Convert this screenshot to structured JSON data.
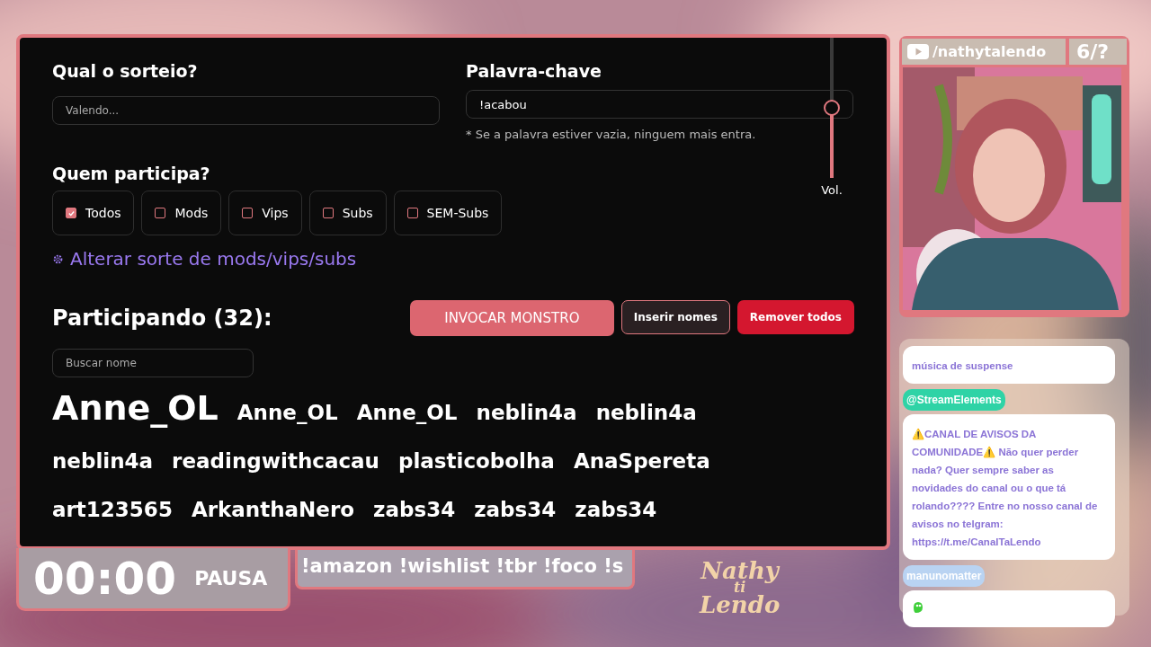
{
  "raffle": {
    "label": "Qual o sorteio?",
    "placeholder": "Valendo..."
  },
  "keyword": {
    "label": "Palavra-chave",
    "value": "!acabou",
    "hint": "* Se a palavra estiver vazia, ninguem mais entra."
  },
  "volume": {
    "label": "Vol.",
    "level": 0.5
  },
  "filter": {
    "label": "Quem participa?",
    "options": [
      {
        "label": "Todos",
        "checked": true
      },
      {
        "label": "Mods",
        "checked": false
      },
      {
        "label": "Vips",
        "checked": false
      },
      {
        "label": "Subs",
        "checked": false
      },
      {
        "label": "SEM-Subs",
        "checked": false
      }
    ]
  },
  "luck_link": "Alterar sorte de mods/vips/subs",
  "participants": {
    "title": "Participando (32):",
    "search": {
      "placeholder": "Buscar nome"
    },
    "actions": [
      {
        "label": "INVOCAR MONSTRO",
        "kind": "primary"
      },
      {
        "label": "Inserir nomes",
        "kind": "secondary"
      },
      {
        "label": "Remover todos",
        "kind": "danger"
      }
    ],
    "names": [
      {
        "name": "Anne_OL",
        "kind": "highlighted"
      },
      {
        "name": "Anne_OL",
        "kind": "normal"
      },
      {
        "name": "Anne_OL",
        "kind": "normal"
      },
      {
        "name": "neblin4a",
        "kind": "normal"
      },
      {
        "name": "neblin4a",
        "kind": "normal"
      },
      {
        "name": "neblin4a",
        "kind": "normal"
      },
      {
        "name": "readingwithcacau",
        "kind": "normal"
      },
      {
        "name": "plasticobolha",
        "kind": "normal"
      },
      {
        "name": "AnaSpereta",
        "kind": "normal"
      },
      {
        "name": "art123565",
        "kind": "normal"
      },
      {
        "name": "ArkanthaNero",
        "kind": "normal"
      },
      {
        "name": "zabs34",
        "kind": "normal"
      },
      {
        "name": "zabs34",
        "kind": "normal"
      },
      {
        "name": "zabs34",
        "kind": "normal"
      }
    ]
  },
  "timer": {
    "time": "00:00",
    "state": "PAUSA"
  },
  "ticker": "!amazon !wishlist !tbr !foco !s",
  "logo": [
    "Nathy",
    "ti",
    "Lendo"
  ],
  "channel": {
    "handle": "/nathytalendo",
    "counter": "6/?"
  },
  "chat": [
    {
      "kind": "text",
      "text": "música de suspense"
    },
    {
      "kind": "text",
      "user": "@StreamElements",
      "color": "#2fd3a6",
      "text": "⚠️CANAL DE AVISOS DA COMUNIDADE⚠️ Não quer perder nada? Quer sempre saber as novidades do canal ou o que tá rolando???? Entre no nosso canal de avisos no telgram: https://t.me/CanalTaLendo"
    },
    {
      "kind": "emote",
      "user": "manunomatter",
      "color": "#b9d3f2"
    }
  ]
}
